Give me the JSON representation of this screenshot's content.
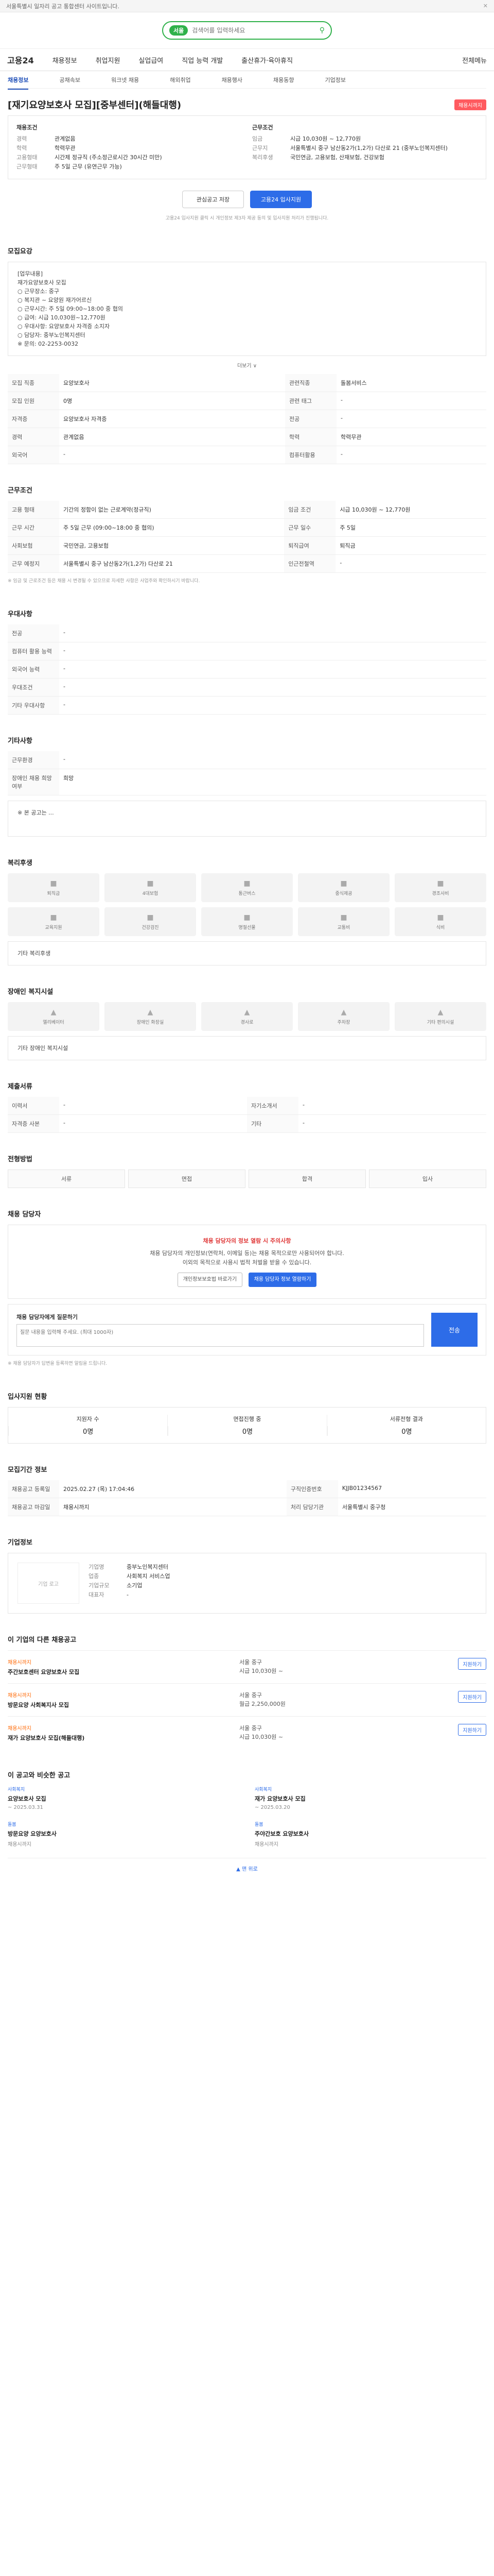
{
  "topbar": {
    "notice": "서울특별시 일자리 공고 통합센터 사이트입니다.",
    "close": "✕"
  },
  "header": {
    "pill": "서울",
    "search_placeholder": "검색어를 입력하세요"
  },
  "nav": {
    "brand": "고용24",
    "items": [
      "채용정보",
      "취업지원",
      "실업급여",
      "직업 능력 개발",
      "출산휴가·육아휴직"
    ],
    "right": "전체메뉴"
  },
  "subnav": [
    "채용정보",
    "공채속보",
    "워크넷 채용",
    "해외취업",
    "채용행사",
    "채용동향",
    "기업정보"
  ],
  "job": {
    "title": "[재기요양보호사 모집][중부센터](해들대행)",
    "badge": "채용시까지",
    "summary_left_title": "채용조건",
    "summary_right_title": "근무조건",
    "left": [
      {
        "k": "경력",
        "v": "관계없음"
      },
      {
        "k": "학력",
        "v": "학력무관"
      },
      {
        "k": "고용형태",
        "v": "시간제 정규직 (주소정근로시간 30시간 미만)"
      },
      {
        "k": "근무형태",
        "v": "주 5일 근무 (유연근무 가능)"
      }
    ],
    "right": [
      {
        "k": "임금",
        "v": "시급 10,030원 ~ 12,770원"
      },
      {
        "k": "근무지",
        "v": "서울특별시 중구 남산동2가(1,2가) 다산로 21 (중부노인복지센터)"
      },
      {
        "k": "복리후생",
        "v": "국민연금, 고용보험, 산재보험, 건강보험"
      }
    ]
  },
  "buttons": {
    "save": "관심공고 저장",
    "apply": "고용24 입사지원"
  },
  "apply_note": "고용24 입사지원 클릭 시 개인정보 제3자 제공 동의 및 입사지원 처리가 진행됩니다.",
  "sections": {
    "detail": {
      "title": "모집요강",
      "body": [
        "[업무내용]",
        "재가요양보호사 모집",
        "○ 근무장소: 중구",
        "○ 복지관 ~ 요양원 재가어르신",
        "○ 근무시간: 주 5일 09:00~18:00 중 협의",
        "○ 급여: 시급 10,030원~12,770원",
        "○ 우대사항: 요양보호사 자격증 소지자",
        "○ 담당자: 중부노인복지센터",
        "※ 문의: 02-2253-0032"
      ],
      "more": "더보기 ∨"
    },
    "recruit_table": [
      {
        "k": "모집 직종",
        "v": "요양보호사",
        "k2": "관련직종",
        "v2": "돌봄서비스"
      },
      {
        "k": "모집 인원",
        "v": "0명",
        "k2": "관련 태그",
        "v2": "-"
      },
      {
        "k": "자격증",
        "v": "요양보호사 자격증",
        "k2": "전공",
        "v2": "-"
      },
      {
        "k": "경력",
        "v": "관계없음",
        "k2": "학력",
        "v2": "학력무관"
      },
      {
        "k": "외국어",
        "v": "-",
        "k2": "컴퓨터활용",
        "v2": "-"
      }
    ],
    "work_title": "근무조건",
    "work_table": [
      {
        "k": "고용 형태",
        "v": "기간의 정함이 없는 근로계약(정규직)",
        "k2": "임금 조건",
        "v2": "시급 10,030원 ~ 12,770원"
      },
      {
        "k": "근무 시간",
        "v": "주 5일 근무 (09:00~18:00 중 협의)",
        "k2": "근무 일수",
        "v2": "주 5일"
      },
      {
        "k": "사회보험",
        "v": "국민연금, 고용보험",
        "k2": "퇴직급여",
        "v2": "퇴직금"
      },
      {
        "k": "근무 예정지",
        "v": "서울특별시 중구 남산동2가(1,2가) 다산로 21",
        "k2": "인근전철역",
        "v2": "-"
      }
    ],
    "work_note": "※ 임금 및 근로조건 등은 채용 시 변경될 수 있으므로 자세한 사항은 사업주와 확인하시기 바랍니다.",
    "pref_title": "우대사항",
    "pref_table": [
      {
        "k": "전공",
        "v": "-"
      },
      {
        "k": "컴퓨터 활용 능력",
        "v": "-"
      },
      {
        "k": "외국어 능력",
        "v": "-"
      },
      {
        "k": "우대조건",
        "v": "-"
      },
      {
        "k": "기타 우대사항",
        "v": "-"
      }
    ],
    "etc_title": "기타사항",
    "etc_table": [
      {
        "k": "근무환경",
        "v": "-"
      },
      {
        "k": "장애인 채용 희망 여부",
        "v": "희망"
      }
    ],
    "etc_note": "※ 본 공고는 ...",
    "welfare_title": "복리후생",
    "welfare": [
      "퇴직금",
      "4대보험",
      "통근버스",
      "중식제공",
      "경조사비",
      "교육지원",
      "건강검진",
      "명절선물",
      "교통비",
      "식비"
    ],
    "welfare_etc": "기타 복리후생",
    "disabled_title": "장애인 복지시설",
    "disabled": [
      "엘리베이터",
      "장애인 화장실",
      "경사로",
      "주차장",
      "기타 편의시설"
    ],
    "disabled_etc": "기타 장애인 복지시설",
    "doc_title": "제출서류",
    "doc_table": [
      {
        "k": "이력서",
        "v": "-",
        "k2": "자기소개서",
        "v2": "-"
      },
      {
        "k": "자격증 사본",
        "v": "-",
        "k2": "기타",
        "v2": "-"
      }
    ],
    "process_title": "전형방법",
    "steps": [
      "서류",
      "면접",
      "합격",
      "입사"
    ],
    "contact_title": "채용 담당자",
    "warn_title": "채용 담당자의 정보 열람 시 주의사항",
    "warn_lines": [
      "채용 담당자의 개인정보(연락처, 이메일 등)는 채용 목적으로만 사용되어야 합니다.",
      "이외의 목적으로 사용시 법적 처벌을 받을 수 있습니다."
    ],
    "warn_btn1": "개인정보보호법 바로가기",
    "warn_btn2": "채용 담당자 정보 열람하기",
    "inquiry_title": "채용 담당자에게 질문하기",
    "inquiry_placeholder": "질문 내용을 입력해 주세요. (최대 1000자)",
    "inquiry_send": "전송",
    "inquiry_note": "※ 채용 담당자가 답변을 등록하면 알림을 드립니다.",
    "applicants_title": "입사지원 현황",
    "applicants": [
      {
        "label": "지원자 수",
        "n": "0명"
      },
      {
        "label": "면접진행 중",
        "n": "0명"
      },
      {
        "label": "서류전형 결과",
        "n": "0명"
      }
    ],
    "posting_title": "모집기간 정보",
    "posting_table": [
      {
        "k": "채용공고 등록일",
        "v": "2025.02.27 (목) 17:04:46",
        "k2": "구직인증번호",
        "v2": "KJJB01234567"
      },
      {
        "k": "채용공고 마감일",
        "v": "채용시까지",
        "k2": "처리 담당기관",
        "v2": "서울특별시 중구청"
      }
    ],
    "company_title": "기업정보",
    "company_logo": "기업 로고",
    "company_info": [
      {
        "k": "기업명",
        "v": "중부노인복지센터"
      },
      {
        "k": "업종",
        "v": "사회복지 서비스업"
      },
      {
        "k": "기업규모",
        "v": "소기업"
      },
      {
        "k": "대표자",
        "v": "-"
      }
    ],
    "other_jobs_title": "이 기업의 다른 채용공고",
    "other_jobs": [
      {
        "tag": "채용시까지",
        "name": "주간보호센터 요양보호사 모집",
        "loc": "서울 중구",
        "pay": "시급 10,030원 ~",
        "apply": "지원하기"
      },
      {
        "tag": "채용시까지",
        "name": "방문요양 사회복지사 모집",
        "loc": "서울 중구",
        "pay": "월급 2,250,000원",
        "apply": "지원하기"
      },
      {
        "tag": "채용시까지",
        "name": "재가 요양보호사 모집(해들대행)",
        "loc": "서울 중구",
        "pay": "시급 10,030원 ~",
        "apply": "지원하기"
      }
    ],
    "rec_title": "이 공고와 비슷한 공고",
    "rec": [
      {
        "tag": "사회복지",
        "name": "요양보호사 모집",
        "date": "~ 2025.03.31"
      },
      {
        "tag": "사회복지",
        "name": "재가 요양보호사 모집",
        "date": "~ 2025.03.20"
      },
      {
        "tag": "돌봄",
        "name": "방문요양 요양보호사",
        "date": "채용시까지"
      },
      {
        "tag": "돌봄",
        "name": "주야간보호 요양보호사",
        "date": "채용시까지"
      }
    ],
    "top_link": "▲ 맨 위로"
  }
}
